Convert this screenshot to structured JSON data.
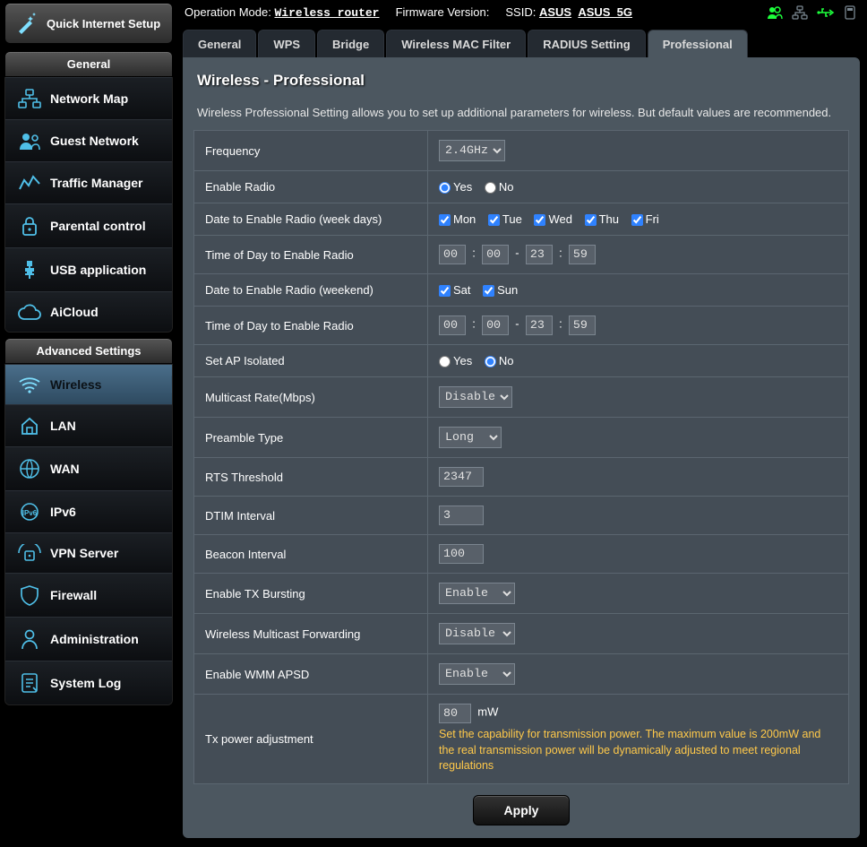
{
  "quick_setup_label": "Quick Internet Setup",
  "topbar": {
    "op_mode_label": "Operation Mode:",
    "op_mode_value": "Wireless  router",
    "fw_label": "Firmware Version:",
    "ssid_label": "SSID:",
    "ssid1": "ASUS",
    "ssid2": "ASUS_5G"
  },
  "sections": {
    "general": "General",
    "advanced": "Advanced Settings"
  },
  "sidebar_general": [
    {
      "id": "network-map",
      "label": "Network Map"
    },
    {
      "id": "guest-network",
      "label": "Guest Network"
    },
    {
      "id": "traffic-manager",
      "label": "Traffic Manager"
    },
    {
      "id": "parental-control",
      "label": "Parental control"
    },
    {
      "id": "usb-application",
      "label": "USB application"
    },
    {
      "id": "aicloud",
      "label": "AiCloud"
    }
  ],
  "sidebar_advanced": [
    {
      "id": "wireless",
      "label": "Wireless",
      "active": true
    },
    {
      "id": "lan",
      "label": "LAN"
    },
    {
      "id": "wan",
      "label": "WAN"
    },
    {
      "id": "ipv6",
      "label": "IPv6"
    },
    {
      "id": "vpn-server",
      "label": "VPN Server"
    },
    {
      "id": "firewall",
      "label": "Firewall"
    },
    {
      "id": "administration",
      "label": "Administration"
    },
    {
      "id": "system-log",
      "label": "System Log"
    }
  ],
  "tabs": [
    {
      "id": "general",
      "label": "General"
    },
    {
      "id": "wps",
      "label": "WPS"
    },
    {
      "id": "bridge",
      "label": "Bridge"
    },
    {
      "id": "mac-filter",
      "label": "Wireless MAC Filter"
    },
    {
      "id": "radius",
      "label": "RADIUS Setting"
    },
    {
      "id": "professional",
      "label": "Professional",
      "active": true
    }
  ],
  "page": {
    "title": "Wireless - Professional",
    "desc": "Wireless Professional Setting allows you to set up additional parameters for wireless. But default values are recommended."
  },
  "form": {
    "frequency": {
      "label": "Frequency",
      "value": "2.4GHz"
    },
    "enable_radio": {
      "label": "Enable Radio",
      "yes": "Yes",
      "no": "No",
      "value": "Yes"
    },
    "weekday_label": "Date to Enable Radio (week days)",
    "weekdays": {
      "mon": "Mon",
      "tue": "Tue",
      "wed": "Wed",
      "thu": "Thu",
      "fri": "Fri"
    },
    "time_label": "Time of Day to Enable Radio",
    "time1": {
      "h1": "00",
      "m1": "00",
      "h2": "23",
      "m2": "59"
    },
    "weekend_label": "Date to Enable Radio (weekend)",
    "weekend": {
      "sat": "Sat",
      "sun": "Sun"
    },
    "time2": {
      "h1": "00",
      "m1": "00",
      "h2": "23",
      "m2": "59"
    },
    "ap_isolated": {
      "label": "Set AP Isolated",
      "yes": "Yes",
      "no": "No",
      "value": "No"
    },
    "mcast_rate": {
      "label": "Multicast Rate(Mbps)",
      "value": "Disable"
    },
    "preamble": {
      "label": "Preamble Type",
      "value": "Long"
    },
    "rts": {
      "label": "RTS Threshold",
      "value": "2347"
    },
    "dtim": {
      "label": "DTIM Interval",
      "value": "3"
    },
    "beacon": {
      "label": "Beacon Interval",
      "value": "100"
    },
    "tx_bursting": {
      "label": "Enable TX Bursting",
      "value": "Enable"
    },
    "wmf": {
      "label": "Wireless Multicast Forwarding",
      "value": "Disable"
    },
    "wmm_apsd": {
      "label": "Enable WMM APSD",
      "value": "Enable"
    },
    "tx_power": {
      "label": "Tx power adjustment",
      "value": "80",
      "unit": "mW",
      "note": "Set the capability for transmission power. The maximum value is 200mW and the real transmission power will be dynamically adjusted to meet regional regulations"
    },
    "apply": "Apply"
  }
}
